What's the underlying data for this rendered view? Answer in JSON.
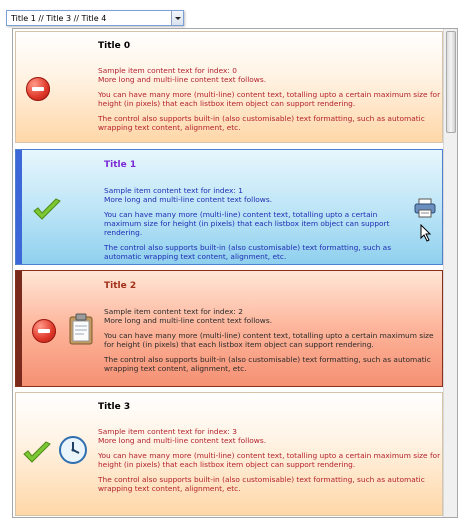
{
  "combo": {
    "value": "Title 1  //  Title 3  //  Title 4"
  },
  "items": [
    {
      "title": "Title 0",
      "line1": "Sample item content text for index: 0",
      "line2": "More long and multi-line content text follows.",
      "p2": "You can have many more (multi-line) content text, totalling upto a certain maximum size for height (in pixels) that each listbox item object can support rendering.",
      "p3": "The control also supports built-in (also customisable) text formatting, such as automatic wrapping text content, alignment, etc."
    },
    {
      "title": "Title 1",
      "line1": "Sample item content text for index: 1",
      "line2": "More long and multi-line content text follows.",
      "p2": "You can have many more (multi-line) content text, totalling upto a certain maximum size for height (in pixels) that each listbox item object can support rendering.",
      "p3": "The control also supports built-in (also customisable) text formatting, such as automatic wrapping text content, alignment, etc."
    },
    {
      "title": "Title 2",
      "line1": "Sample item content text for index: 2",
      "line2": "More long and multi-line content text follows.",
      "p2": "You can have many more (multi-line) content text, totalling upto a certain maximum size for height (in pixels) that each listbox item object can support rendering.",
      "p3": "The control also supports built-in (also customisable) text formatting, such as automatic wrapping text content, alignment, etc."
    },
    {
      "title": "Title 3",
      "line1": "Sample item content text for index: 3",
      "line2": "More long and multi-line content text follows.",
      "p2": "You can have many more (multi-line) content text, totalling upto a certain maximum size for height (in pixels) that each listbox item object can support rendering.",
      "p3": "The control also supports built-in (also customisable) text formatting, such as automatic wrapping text content, alignment, etc."
    }
  ],
  "colors": {
    "item_default": "#ffd7a8",
    "selected_blue": "#8fd0ee",
    "selected_blue_bar": "#3b67d8",
    "selected_red": "#f59073",
    "selected_red_bar": "#7a2a1c",
    "title_default": "#000000",
    "title_blue": "#7b2bd6",
    "title_red": "#a0301a"
  },
  "icons": {
    "item0": [
      "no-entry-icon"
    ],
    "item1": [
      "checkmark-icon",
      "printer-icon",
      "mouse-cursor-icon"
    ],
    "item2": [
      "no-entry-icon",
      "clipboard-icon"
    ],
    "item3": [
      "checkmark-icon",
      "clock-icon"
    ]
  }
}
